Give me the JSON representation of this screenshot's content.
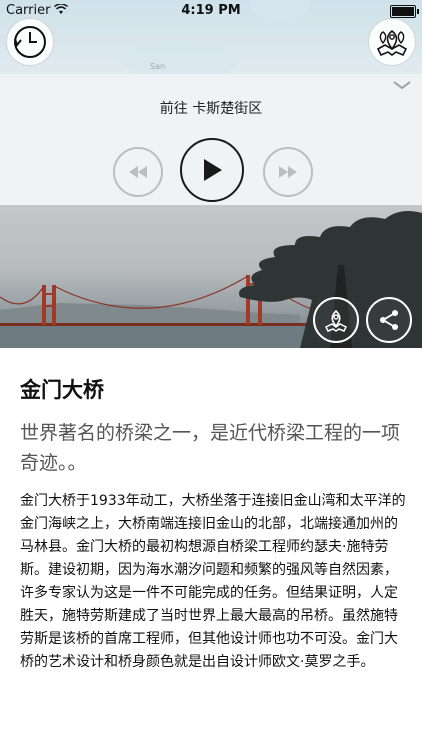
{
  "status_bar": {
    "carrier": "Carrier",
    "time": "4:19 PM"
  },
  "map": {
    "label": "San"
  },
  "player": {
    "route_title": "前往 卡斯楚街区"
  },
  "article": {
    "title": "金门大桥",
    "subtitle": "世界著名的桥梁之一，是近代桥梁工程的一项奇迹。。",
    "body": "金门大桥于1933年动工，大桥坐落于连接旧金山湾和太平洋的金门海峡之上，大桥南端连接旧金山的北部，北端接通加州的马林县。金门大桥的最初构想源自桥梁工程师约瑟夫·施特劳斯。建设初期，因为海水潮汐问题和频繁的强风等自然因素，许多专家认为这是一件不可能完成的任务。但结果证明，人定胜天，施特劳斯建成了当时世界上最大最高的吊桥。虽然施特劳斯是该桥的首席工程师，但其他设计师也功不可没。金门大桥的艺术设计和桥身颜色就是出自设计师欧文·莫罗之手。"
  },
  "icons": {
    "history": "history-clock-icon",
    "places": "map-pins-icon",
    "rewind": "rewind-icon",
    "play": "play-icon",
    "forward": "fast-forward-icon",
    "map_pin": "map-pin-icon",
    "share": "share-icon",
    "collapse": "chevron-down-icon"
  },
  "colors": {
    "accent": "#1a1a1a",
    "disabled": "#b9bec1",
    "bridge": "#a23a2a"
  }
}
